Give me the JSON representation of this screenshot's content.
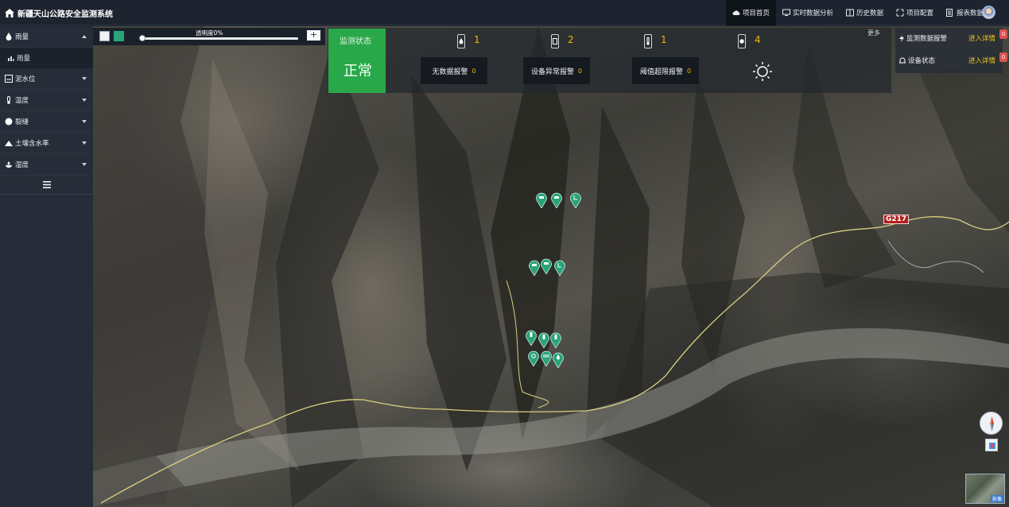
{
  "app": {
    "title": "新疆天山公路安全监测系统"
  },
  "nav": {
    "items": [
      {
        "label": "项目首页",
        "active": true,
        "icon": "cloud-icon"
      },
      {
        "label": "实时数据分析",
        "active": false,
        "icon": "monitor-icon"
      },
      {
        "label": "历史数据",
        "active": false,
        "icon": "history-icon"
      },
      {
        "label": "项目配置",
        "active": false,
        "icon": "config-icon"
      },
      {
        "label": "报表数据",
        "active": false,
        "icon": "report-icon"
      }
    ]
  },
  "sidebar": {
    "items": [
      {
        "label": "雨量",
        "icon": "raindrop-icon",
        "expanded": true,
        "sub": [
          {
            "label": "雨量",
            "icon": "bar-chart-icon"
          }
        ]
      },
      {
        "label": "泥水位",
        "icon": "water-level-icon",
        "expanded": false
      },
      {
        "label": "温度",
        "icon": "thermometer-icon",
        "expanded": false
      },
      {
        "label": "裂缝",
        "icon": "crack-icon",
        "expanded": false
      },
      {
        "label": "土壤含水率",
        "icon": "soil-moisture-icon",
        "expanded": false
      },
      {
        "label": "湿度",
        "icon": "humidity-icon",
        "expanded": false
      }
    ]
  },
  "layer_control": {
    "opacity_label": "透明度0%",
    "opacity_value": 0,
    "plus": "+"
  },
  "status": {
    "title": "监测状态",
    "value": "正常",
    "sensors": [
      {
        "icon": "raindrop-icon",
        "count": "1"
      },
      {
        "icon": "water-level-icon",
        "count": "2"
      },
      {
        "icon": "thermometer-icon",
        "count": "1"
      },
      {
        "icon": "crack-icon",
        "count": "4"
      }
    ],
    "alarms": [
      {
        "label": "无数据报警",
        "count": "0"
      },
      {
        "label": "设备异常报警",
        "count": "0"
      },
      {
        "label": "阈值超限报警",
        "count": "0"
      }
    ],
    "weather_icon": "sun-icon",
    "more": "更多"
  },
  "right_panel": {
    "rows": [
      {
        "label": "监测数据报警",
        "link": "进入详情",
        "badge": "0"
      },
      {
        "label": "设备状态",
        "link": "进入详情",
        "badge": "0"
      }
    ]
  },
  "map": {
    "road_tag": "G217",
    "minimap_label": "影像"
  },
  "colors": {
    "accent": "#29a84a",
    "alarm_count": "#f0b400",
    "link": "#f0c419",
    "marker": "#2aa37a"
  }
}
